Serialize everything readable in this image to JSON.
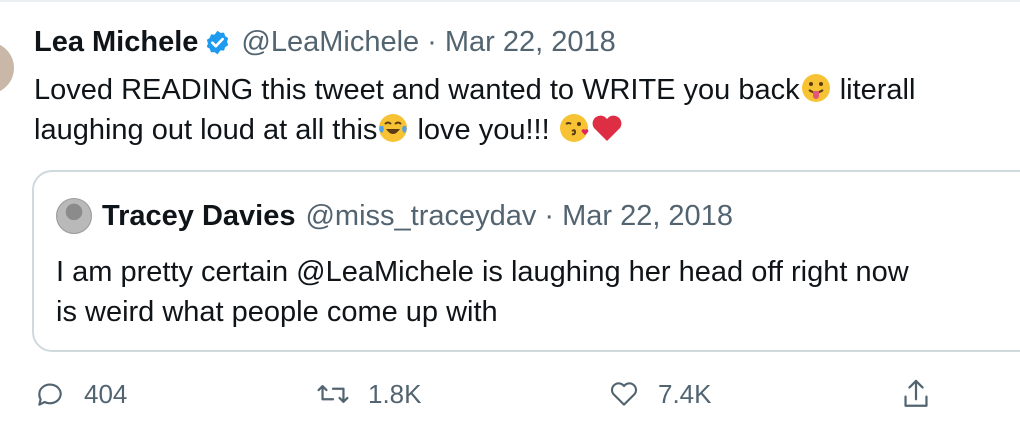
{
  "tweet": {
    "author_name": "Lea Michele",
    "handle": "@LeaMichele",
    "separator": "·",
    "date": "Mar 22, 2018",
    "line1_part1": "Loved READING this tweet and wanted to WRITE you back",
    "line1_part2": " literall",
    "line2_part1": "laughing out loud at all this",
    "line2_part2": " love you!!! ",
    "emoji": {
      "tongue": "tongue-face-emoji",
      "laugh": "tears-of-joy-emoji",
      "kiss": "face-blowing-kiss-emoji",
      "heart": "red-heart-emoji"
    }
  },
  "quote": {
    "author_name": "Tracey Davies",
    "handle": "@miss_traceydav",
    "separator": "·",
    "date": "Mar 22, 2018",
    "line1": "I am pretty certain @LeaMichele is laughing her head off right now",
    "line2": "is weird what people come up with"
  },
  "actions": {
    "reply_count": "404",
    "retweet_count": "1.8K",
    "like_count": "7.4K"
  },
  "colors": {
    "verified": "#1d9bf0",
    "meta": "#536471",
    "border": "#cfd9de"
  }
}
